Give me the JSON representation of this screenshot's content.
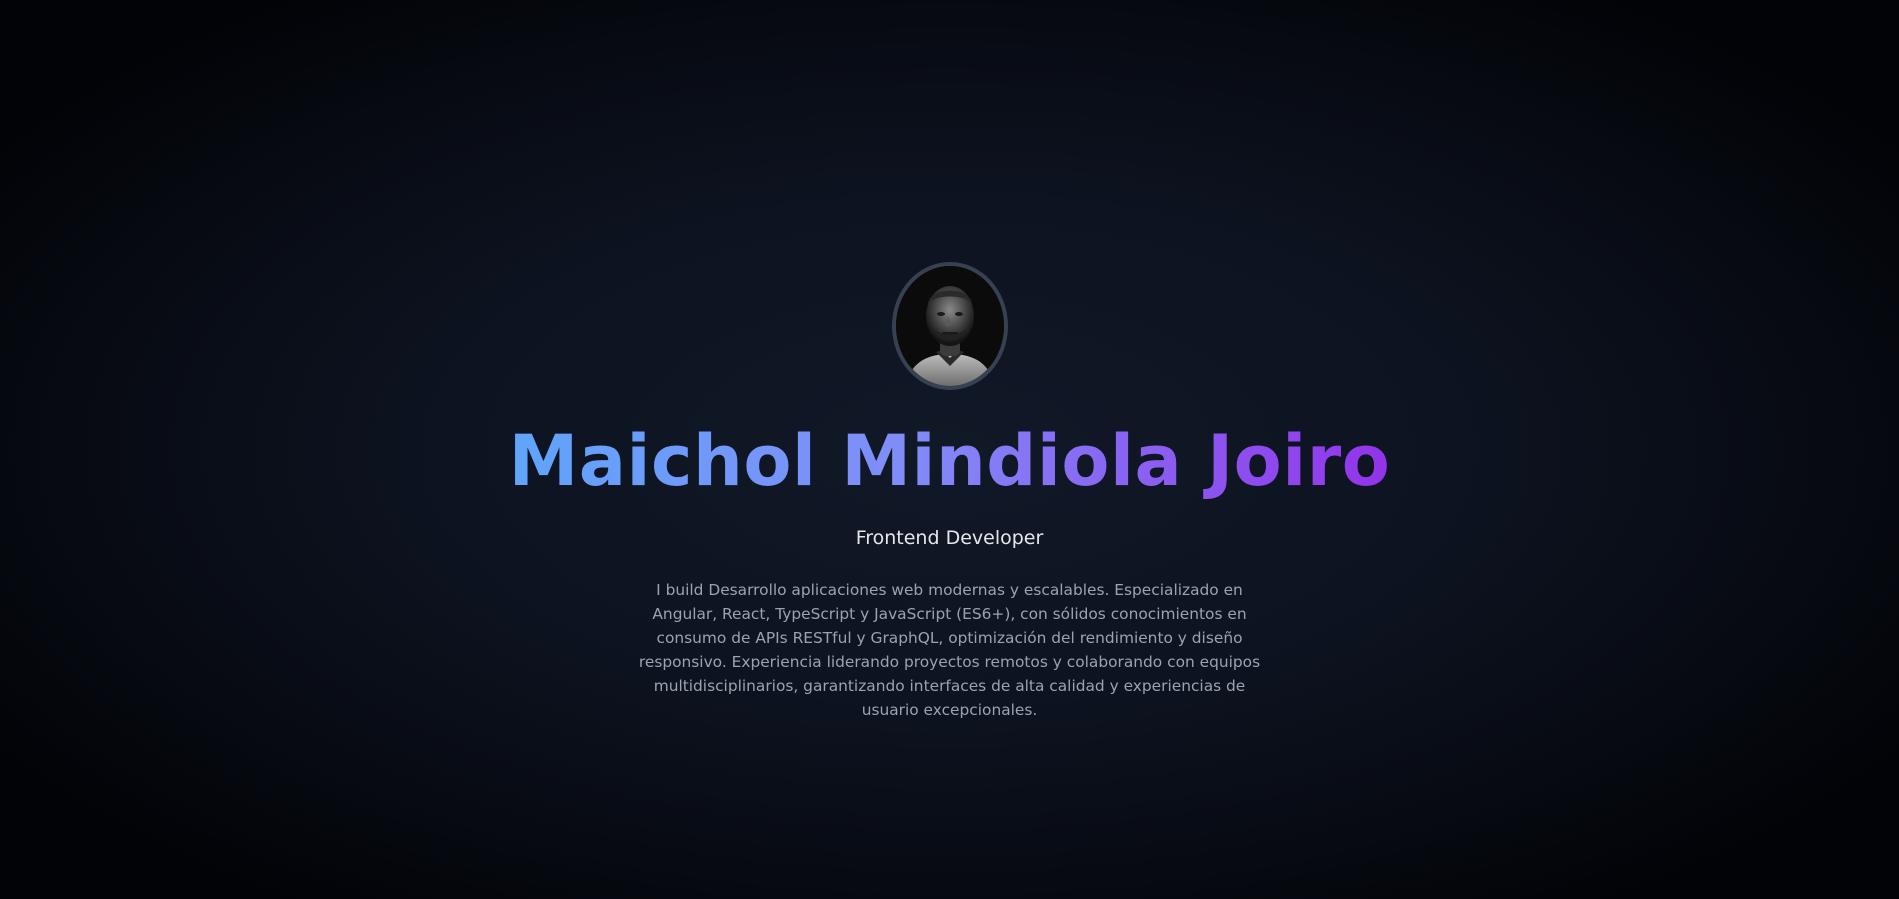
{
  "profile": {
    "avatar_icon": "profile-photo",
    "name": "Maichol Mindiola Joiro",
    "role": "Frontend Developer",
    "bio": "I build Desarrollo aplicaciones web modernas y escalables. Especializado en Angular, React, TypeScript y JavaScript (ES6+), con sólidos conocimientos en consumo de APIs RESTful y GraphQL, optimización del rendimiento y diseño responsivo. Experiencia liderando proyectos remotos y colaborando con equipos multidisciplinarios, garantizando interfaces de alta calidad y experiencias de usuario excepcionales."
  },
  "colors": {
    "background": "#0d1320",
    "name_gradient_start": "#60a5fa",
    "name_gradient_end": "#9333ea",
    "avatar_border": "#374151",
    "role_text": "#e5e7eb",
    "bio_text": "#9ca3af"
  }
}
